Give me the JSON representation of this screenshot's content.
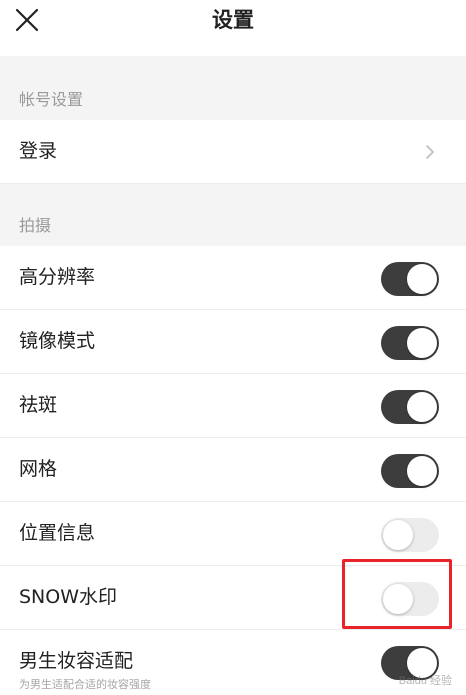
{
  "header": {
    "title": "设置"
  },
  "sections": {
    "account": {
      "label": "帐号设置"
    },
    "capture": {
      "label": "拍摄"
    }
  },
  "rows": {
    "login": {
      "label": "登录"
    },
    "high_res": {
      "label": "高分辨率",
      "toggle": "on"
    },
    "mirror": {
      "label": "镜像模式",
      "toggle": "on"
    },
    "blemish": {
      "label": "祛斑",
      "toggle": "on"
    },
    "grid": {
      "label": "网格",
      "toggle": "on"
    },
    "location": {
      "label": "位置信息",
      "toggle": "off"
    },
    "snow_watermark": {
      "label": "SNOW水印",
      "toggle": "off"
    },
    "male_makeup": {
      "label": "男生妆容适配",
      "sublabel": "为男生适配合适的妆容强度",
      "toggle": "on"
    }
  },
  "icons": {
    "close": "close-icon",
    "chevron": "chevron-right-icon"
  },
  "colors": {
    "toggle_on": "#3d3d3d",
    "toggle_off": "#ececec",
    "highlight": "#e8232a"
  },
  "watermark": {
    "text": "Baidu 经验"
  }
}
